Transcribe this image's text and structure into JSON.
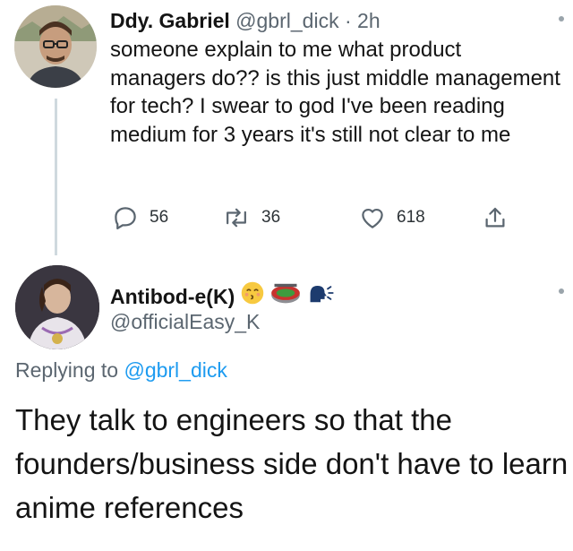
{
  "tweet": {
    "author_name": "Ddy. Gabriel",
    "author_handle": "@gbrl_dick",
    "separator": " · ",
    "time": "2h",
    "text": "someone explain to me what product managers do?? is this just middle management for tech? I swear to god I've been reading medium for 3 years it's still not clear to me",
    "replies": "56",
    "retweets": "36",
    "likes": "618"
  },
  "reply": {
    "author_name": "Antibod-e(K)",
    "author_handle": "@officialEasy_K",
    "emojis": [
      "kissing-face-emoji",
      "stadium-emoji",
      "speaking-head-emoji"
    ],
    "replying_prefix": "Replying to ",
    "replying_to": "@gbrl_dick",
    "text": "They talk to engineers so that the founders/business side don't have to learn anime references"
  },
  "colors": {
    "text": "#141414",
    "secondary": "#5b6670",
    "link": "#1d9bf0",
    "thread_line": "#cfd9de"
  }
}
